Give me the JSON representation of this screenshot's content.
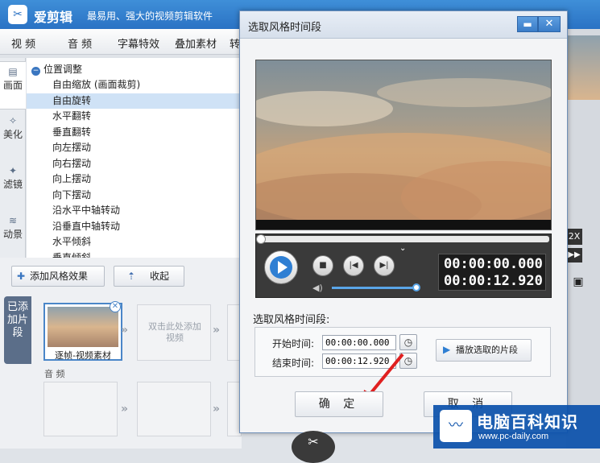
{
  "app": {
    "name": "爱剪辑",
    "tagline": "最易用、强大的视频剪辑软件"
  },
  "tabs": [
    "视 频",
    "音 频",
    "字幕特效",
    "叠加素材",
    "转"
  ],
  "side_tabs": [
    {
      "label": "画面",
      "icon": "image-icon"
    },
    {
      "label": "美化",
      "icon": "magic-icon"
    },
    {
      "label": "滤镜",
      "icon": "filter-icon"
    },
    {
      "label": "动景",
      "icon": "wave-icon"
    }
  ],
  "effects": {
    "group": "位置调整",
    "items": [
      "自由缩放 (画面裁剪)",
      "自由旋转",
      "水平翻转",
      "垂直翻转",
      "向左摆动",
      "向右摆动",
      "向上摆动",
      "向下摆动",
      "沿水平中轴转动",
      "沿垂直中轴转动",
      "水平倾斜",
      "垂直倾斜"
    ],
    "selected_index": 1
  },
  "buttons": {
    "add_effect": "添加风格效果",
    "collapse": "收起"
  },
  "added": {
    "tab_label": "已添加片段",
    "clip_name": "逐帧-视频素材",
    "placeholder": "双击此处添加视频",
    "audio_label": "音 频"
  },
  "dialog": {
    "title": "选取风格时间段",
    "current_time": "00:00:00.000",
    "total_time": "00:00:12.920",
    "section_label": "选取风格时间段:",
    "start_label": "开始时间:",
    "start_value": "00:00:00.000",
    "end_label": "结束时间:",
    "end_value": "00:00:12.920",
    "play_selected": "播放选取的片段",
    "ok": "确 定",
    "cancel": "取 消"
  },
  "right_panel": {
    "speed": "2X"
  },
  "watermark": {
    "title": "电脑百科知识",
    "url": "www.pc-daily.com"
  },
  "colors": {
    "accent": "#2a72c4",
    "selection": "#cfe2f6",
    "arrow": "#e02020"
  }
}
